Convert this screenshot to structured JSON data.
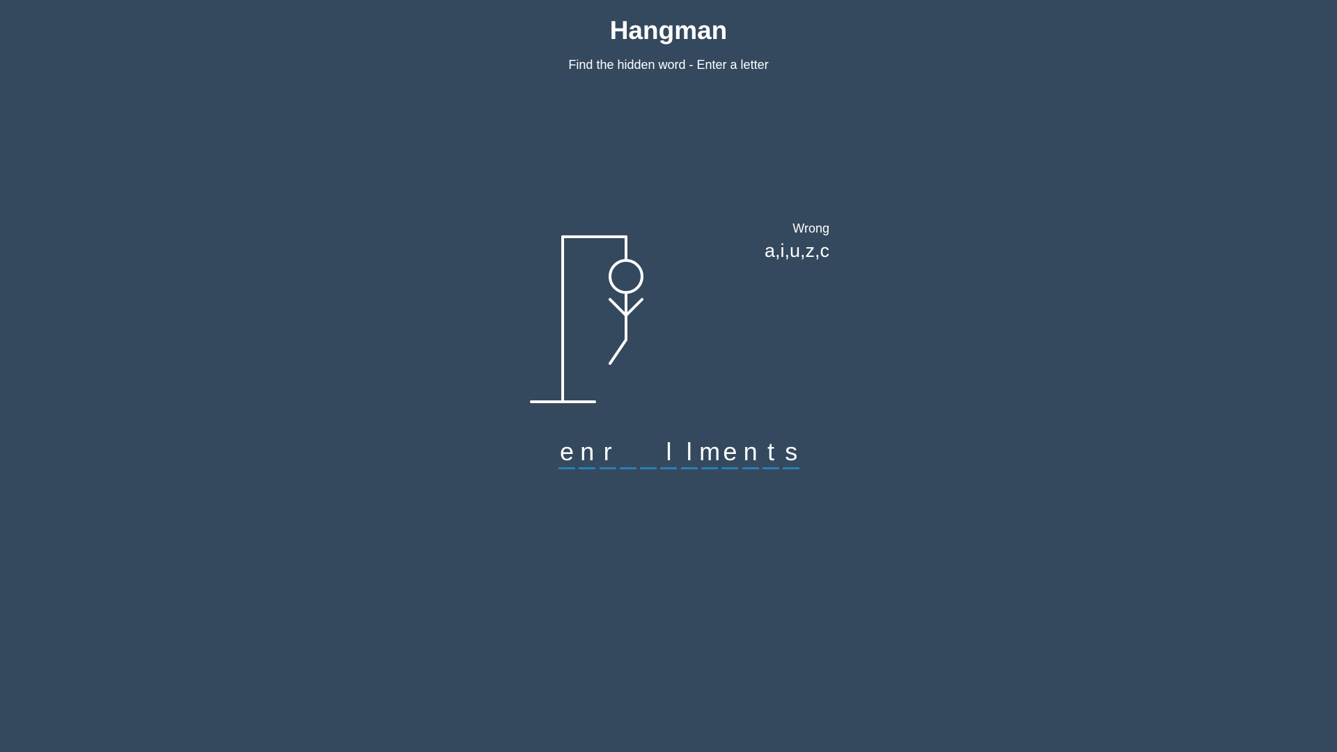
{
  "header": {
    "title": "Hangman",
    "subtitle": "Find the hidden word - Enter a letter"
  },
  "wrong": {
    "label": "Wrong",
    "letters": "a,i,u,z,c"
  },
  "word": {
    "slots": [
      "e",
      "n",
      "r",
      "",
      "",
      "l",
      "l",
      "m",
      "e",
      "n",
      "t",
      "s"
    ]
  },
  "hangman": {
    "parts_shown": [
      "head",
      "body",
      "left-arm",
      "right-arm",
      "left-leg"
    ],
    "wrong_guess_count": 5
  },
  "colors": {
    "background": "#34495e",
    "foreground": "#ffffff",
    "accent": "#2980b9"
  }
}
